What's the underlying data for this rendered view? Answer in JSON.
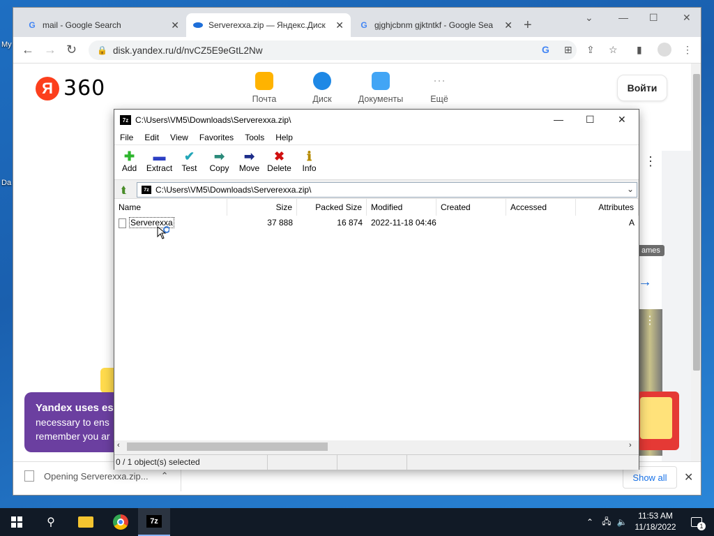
{
  "desktop": {
    "icon_labels": [
      "My",
      "Da"
    ]
  },
  "browser": {
    "tabs": [
      {
        "title": "mail - Google Search",
        "favicon": "G"
      },
      {
        "title": "Serverexxa.zip — Яндекс.Диск",
        "favicon": "disk"
      },
      {
        "title": "gjghjcbnm gjktntkf - Google Sea",
        "favicon": "G"
      }
    ],
    "url": "disk.yandex.ru/d/nvCZ5E9eGtL2Nw",
    "new_tab": "+"
  },
  "yandex": {
    "logo_letter": "Я",
    "logo_text": "360",
    "services": [
      {
        "label": "Почта",
        "color": "#ffb300"
      },
      {
        "label": "Диск",
        "color": "#1e88e5"
      },
      {
        "label": "Документы",
        "color": "#42a5f5"
      },
      {
        "label": "Ещё",
        "color": "#bdbdbd"
      }
    ],
    "login": "Войти",
    "cookie_title": "Yandex uses es",
    "cookie_line2": "necessary to ens",
    "cookie_line3": "remember you ar",
    "side_label": "ames"
  },
  "downloads": {
    "item": "Opening Serverexxa.zip...",
    "show_all": "Show all"
  },
  "zip": {
    "title": "C:\\Users\\VM5\\Downloads\\Serverexxa.zip\\",
    "menu": [
      "File",
      "Edit",
      "View",
      "Favorites",
      "Tools",
      "Help"
    ],
    "tools": [
      {
        "label": "Add",
        "glyph": "✚",
        "color": "#2db52d"
      },
      {
        "label": "Extract",
        "glyph": "▬",
        "color": "#2c3fc4"
      },
      {
        "label": "Test",
        "glyph": "✔",
        "color": "#23a6b8"
      },
      {
        "label": "Copy",
        "glyph": "➡",
        "color": "#2a8a7a"
      },
      {
        "label": "Move",
        "glyph": "➡",
        "color": "#1d2d8a"
      },
      {
        "label": "Delete",
        "glyph": "✖",
        "color": "#d01010"
      },
      {
        "label": "Info",
        "glyph": "ℹ",
        "color": "#b58a00"
      }
    ],
    "address": "C:\\Users\\VM5\\Downloads\\Serverexxa.zip\\",
    "columns": [
      "Name",
      "Size",
      "Packed Size",
      "Modified",
      "Created",
      "Accessed",
      "Attributes"
    ],
    "rows": [
      {
        "name": "Serverexxa",
        "size": "37 888",
        "packed": "16 874",
        "modified": "2022-11-18 04:46",
        "created": "",
        "accessed": "",
        "attributes": "A"
      }
    ],
    "status": "0 / 1 object(s) selected"
  },
  "taskbar": {
    "time": "11:53 AM",
    "date": "11/18/2022",
    "notifications": "1",
    "app_7z": "7z"
  }
}
